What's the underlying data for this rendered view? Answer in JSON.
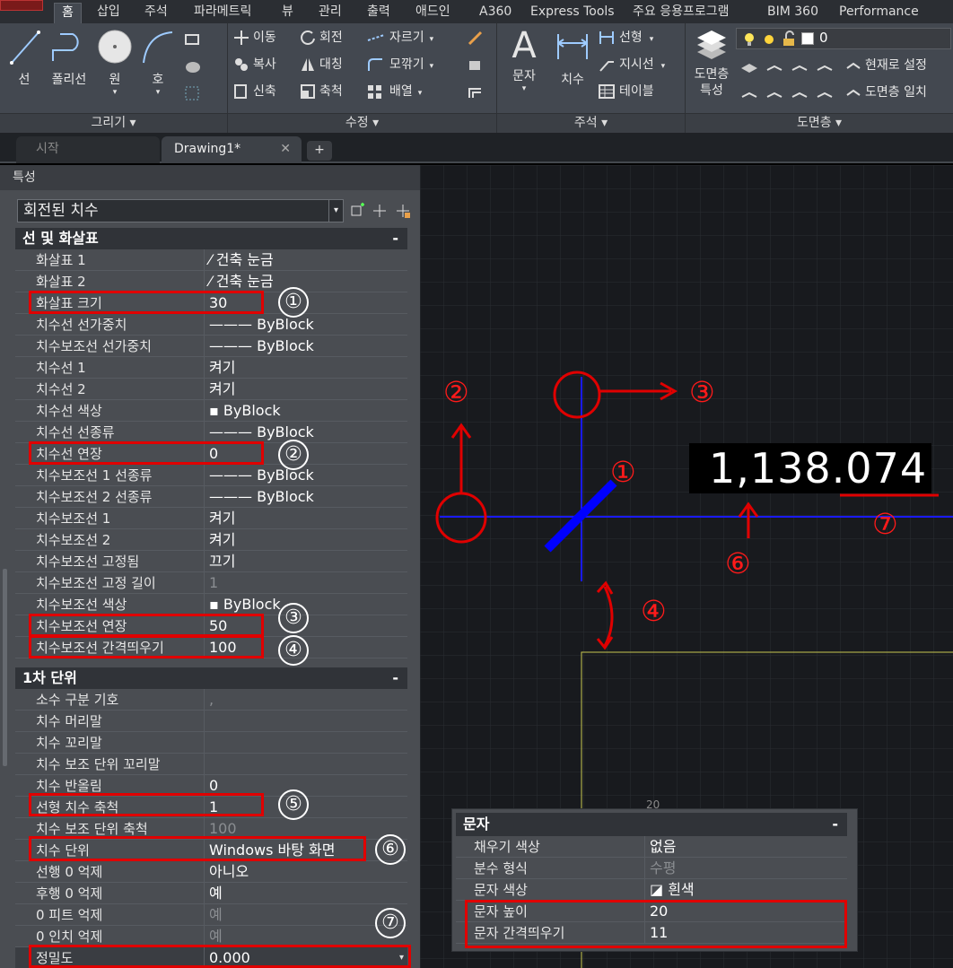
{
  "ribbon": {
    "tabs": [
      "홈",
      "삽입",
      "주석",
      "파라메트릭",
      "뷰",
      "관리",
      "출력",
      "애드인",
      "A360",
      "Express Tools",
      "주요 응용프로그램",
      "BIM 360",
      "Performance"
    ],
    "draw": {
      "line": "선",
      "polyline": "폴리선",
      "circle": "원",
      "arc": "호",
      "panel_title": "그리기 ▾"
    },
    "modify": {
      "move": "이동",
      "rotate": "회전",
      "trim": "자르기",
      "copy": "복사",
      "mirror": "대칭",
      "fillet": "모깎기",
      "stretch": "신축",
      "scale": "축척",
      "array": "배열",
      "panel_title": "수정 ▾"
    },
    "annotation": {
      "text": "문자",
      "dimension": "치수",
      "linear": "선형",
      "leader": "지시선",
      "table": "테이블",
      "panel_title": "주석 ▾"
    },
    "layers": {
      "layer_props": "도면층\n특성",
      "layer_value": "0",
      "set_current": "현재로 설정",
      "match_layer": "도면층 일치",
      "panel_title": "도면층 ▾"
    }
  },
  "filetabs": {
    "start": "시작",
    "drawing": "Drawing1*",
    "close": "✕",
    "add": "+"
  },
  "properties": {
    "title": "특성",
    "object_type": "회전된 치수",
    "section1": "선 및 화살표",
    "section2": "1차 단위",
    "minus": "-",
    "rows1": [
      {
        "k": "화살표 1",
        "v": "⁄ 건축 눈금"
      },
      {
        "k": "화살표 2",
        "v": "⁄ 건축 눈금"
      },
      {
        "k": "화살표 크기",
        "v": "30"
      },
      {
        "k": "치수선 선가중치",
        "v": "——— ByBlock"
      },
      {
        "k": "치수보조선 선가중치",
        "v": "——— ByBlock"
      },
      {
        "k": "치수선 1",
        "v": "켜기"
      },
      {
        "k": "치수선 2",
        "v": "켜기"
      },
      {
        "k": "치수선 색상",
        "v": "▪ ByBlock"
      },
      {
        "k": "치수선 선종류",
        "v": "——— ByBlock"
      },
      {
        "k": "치수선 연장",
        "v": "0"
      },
      {
        "k": "치수보조선 1 선종류",
        "v": "——— ByBlock"
      },
      {
        "k": "치수보조선 2 선종류",
        "v": "——— ByBlock"
      },
      {
        "k": "치수보조선 1",
        "v": "켜기"
      },
      {
        "k": "치수보조선 2",
        "v": "켜기"
      },
      {
        "k": "치수보조선 고정됨",
        "v": "끄기"
      },
      {
        "k": "치수보조선 고정 길이",
        "v": "1"
      },
      {
        "k": "치수보조선 색상",
        "v": "▪ ByBlock"
      },
      {
        "k": "치수보조선 연장",
        "v": "50"
      },
      {
        "k": "치수보조선 간격띄우기",
        "v": "100"
      }
    ],
    "rows2": [
      {
        "k": "소수 구분 기호",
        "v": ","
      },
      {
        "k": "치수 머리말",
        "v": ""
      },
      {
        "k": "치수 꼬리말",
        "v": ""
      },
      {
        "k": "치수 보조 단위 꼬리말",
        "v": ""
      },
      {
        "k": "치수 반올림",
        "v": "0"
      },
      {
        "k": "선형 치수 축척",
        "v": "1"
      },
      {
        "k": "치수 보조 단위 축척",
        "v": "100"
      },
      {
        "k": "치수 단위",
        "v": "Windows 바탕 화면"
      },
      {
        "k": "선행 0 억제",
        "v": "아니오"
      },
      {
        "k": "후행 0 억제",
        "v": "예"
      },
      {
        "k": "0 피트 억제",
        "v": "예"
      },
      {
        "k": "0 인치 억제",
        "v": "예"
      },
      {
        "k": "정밀도",
        "v": "0.000"
      }
    ]
  },
  "text_panel": {
    "section": "문자",
    "rows": [
      {
        "k": "채우기 색상",
        "v": "없음"
      },
      {
        "k": "분수 형식",
        "v": "수평"
      },
      {
        "k": "문자 색상",
        "v": "◪ 흰색"
      },
      {
        "k": "문자 높이",
        "v": "20"
      },
      {
        "k": "문자 간격띄우기",
        "v": "11"
      }
    ]
  },
  "canvas": {
    "dimension_text": "1,138.074",
    "markers": [
      "①",
      "②",
      "③",
      "④",
      "⑤",
      "⑥",
      "⑦"
    ],
    "bottom_label": "20"
  },
  "colors": {
    "highlight": "#e00000",
    "dim_line": "#1a1aff",
    "arrow_blue": "#0000ff",
    "boundary": "#c8c850"
  }
}
